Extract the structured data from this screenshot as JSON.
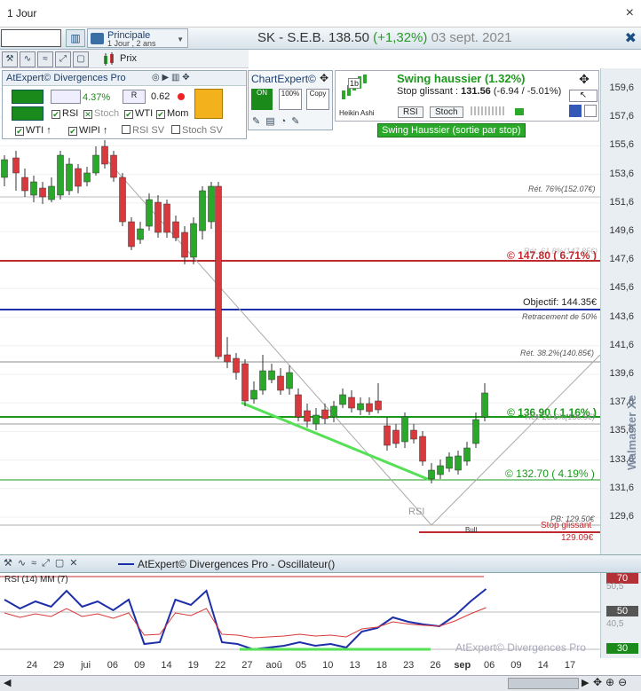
{
  "window": {
    "title": "1 Jour",
    "close": "×"
  },
  "toolbar": {
    "search_value": "",
    "selector_title": "Principale",
    "selector_sub": "1 Jour , 2 ans",
    "symbol": "SK - S.E.B.",
    "price": "138.50",
    "change": "(+1,32%)",
    "date": "03 sept. 2021",
    "price_label": "Prix"
  },
  "atexpert": {
    "title": "AtExpert© Divergences Pro",
    "pct": "4.37%",
    "val": "0.62",
    "checks": [
      "RSI",
      "Stoch",
      "WTI",
      "Mom"
    ],
    "checks2": [
      "WTI",
      "WIPI",
      "RSI SV",
      "Stoch SV"
    ]
  },
  "chartexpert": {
    "title": "ChartExpert©",
    "btn_on": "ON",
    "btn_100": "100%",
    "btn_copy": "Copy"
  },
  "swing": {
    "heikin": "Heikin Ashi",
    "heikin_badge": "1b",
    "title": "Swing haussier (1.32%)",
    "stop_label": "Stop glissant :",
    "stop_value": "131.56",
    "stop_detail": "(-6.94 / -5.01%)",
    "rsi": "RSI",
    "stoch": "Stoch",
    "note": "Swing Haussier (sortie par stop)"
  },
  "price_axis": [
    "159,6",
    "157,6",
    "155,6",
    "153,6",
    "151,6",
    "149,6",
    "147,6",
    "145,6",
    "143,6",
    "141,6",
    "139,6",
    "137,6",
    "135,6",
    "133,6",
    "131,6",
    "129,6"
  ],
  "levels": {
    "ret76": "Rét. 76%(152.07€)",
    "l147": "© 147.80 ( 6.71% )",
    "l147_faint": "Rét. 61.8%(147.85€)",
    "objectif": "Objectif: 144.35€",
    "retr50": "Retracement de 50%",
    "ret382": "Rét. 38.2%(140.85€)",
    "l136": "© 136.90 ( 1.16% )",
    "ret236": "Rét. 23.6%(136.5€)",
    "l132": "© 132.70 ( 4.19% )",
    "rsi_mark": "RSI",
    "pb": "PB: 129.50€",
    "stop": "Stop glissant",
    "stop_val": "129.09€",
    "bull": "Bull"
  },
  "oscillator": {
    "title": "AtExpert© Divergences Pro - Oscillateur()",
    "rsi_label": "RSI (14) MM (7)",
    "axis": [
      "70",
      "50",
      "30"
    ],
    "axis_faint": [
      "50,5",
      "40,5"
    ],
    "watermark": "AtExpert© Divergences Pro"
  },
  "x_axis": [
    "24",
    "29",
    "jui",
    "06",
    "09",
    "14",
    "19",
    "22",
    "27",
    "aoû",
    "05",
    "10",
    "13",
    "18",
    "23",
    "26",
    "sep",
    "06",
    "09",
    "14",
    "17"
  ],
  "brand": "Walmaster Xe",
  "colors": {
    "up": "#2aa82a",
    "down": "#d9393c",
    "support": "#1a9a1a",
    "resistance": "#c0292e",
    "objective": "#1d2fa8",
    "accent": "#1b4f82"
  }
}
